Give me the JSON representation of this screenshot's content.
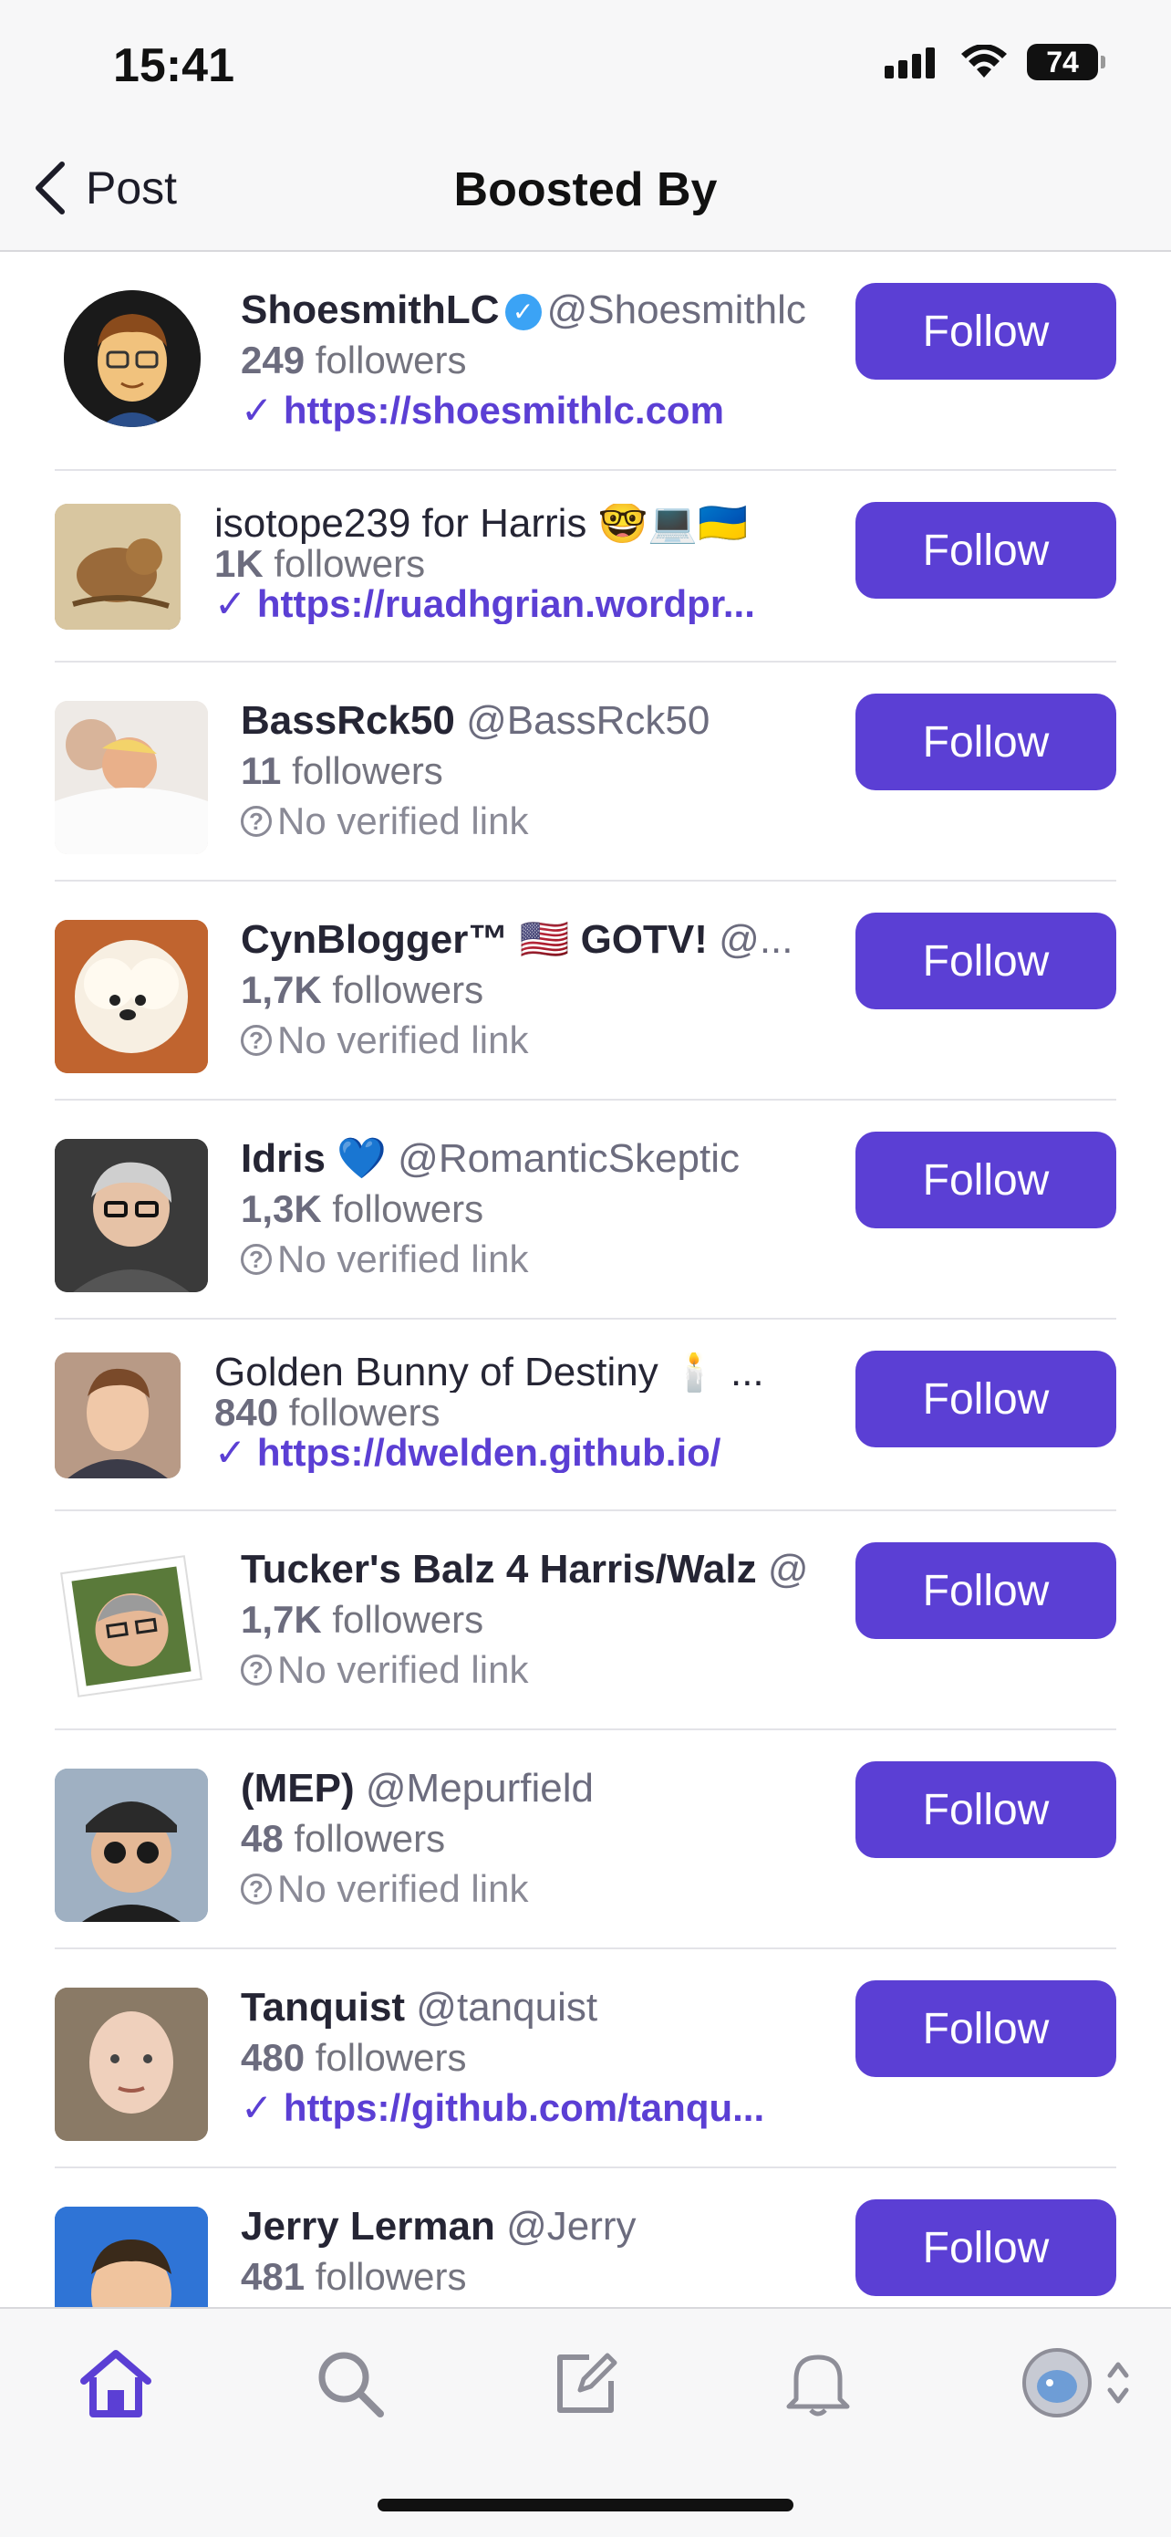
{
  "status": {
    "time": "15:41",
    "battery": "74"
  },
  "nav": {
    "back_label": "Post",
    "title": "Boosted By"
  },
  "follow_label": "Follow",
  "no_link_text": "No verified link",
  "users": [
    {
      "name": "ShoesmithLC",
      "handle": "@Shoesmithlc",
      "count": "249",
      "followers_word": "followers",
      "link": "https://shoesmithlc.com",
      "verified_badge": true
    },
    {
      "name": "isotope239 for Harris 🤓💻🇺🇦",
      "handle": "",
      "count": "1K",
      "followers_word": "followers",
      "link": "https://ruadhgrian.wordpr..."
    },
    {
      "name": "BassRck50",
      "handle": "@BassRck50",
      "count": "11",
      "followers_word": "followers",
      "link": ""
    },
    {
      "name": "CynBlogger™ 🇺🇸 GOTV!",
      "handle": "@...",
      "count": "1,7K",
      "followers_word": "followers",
      "link": ""
    },
    {
      "name": "Idris 💙",
      "handle": "@RomanticSkeptic",
      "count": "1,3K",
      "followers_word": "followers",
      "link": ""
    },
    {
      "name": "Golden Bunny of Destiny 🕯️ ...",
      "handle": "",
      "count": "840",
      "followers_word": "followers",
      "link": "https://dwelden.github.io/"
    },
    {
      "name": "Tucker's Balz 4 Harris/Walz",
      "handle": "@",
      "count": "1,7K",
      "followers_word": "followers",
      "link": ""
    },
    {
      "name": "(MEP)",
      "handle": "@Mepurfield",
      "count": "48",
      "followers_word": "followers",
      "link": ""
    },
    {
      "name": "Tanquist",
      "handle": "@tanquist",
      "count": "480",
      "followers_word": "followers",
      "link": "https://github.com/tanqu..."
    },
    {
      "name": "Jerry Lerman",
      "handle": "@Jerry",
      "count": "481",
      "followers_word": "followers",
      "link": ""
    }
  ],
  "colors": {
    "accent": "#5b3fd4",
    "verified": "#3ba3f5"
  },
  "tabs": [
    "home-icon",
    "search-icon",
    "compose-icon",
    "bell-icon",
    "profile-avatar"
  ]
}
